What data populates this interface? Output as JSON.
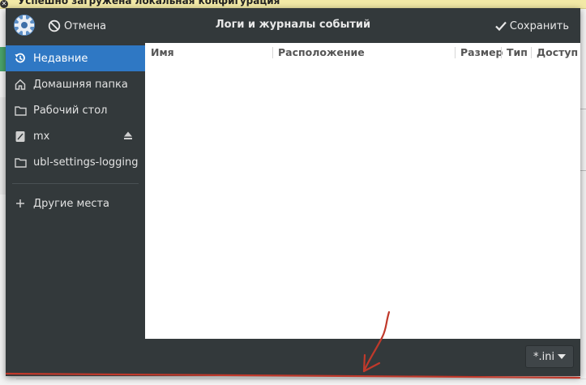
{
  "background": {
    "banner_text": "Успешно загружена локальная конфигурация"
  },
  "dialog": {
    "title": "Логи и журналы событий",
    "cancel_label": "Отмена",
    "save_label": "Сохранить"
  },
  "sidebar": {
    "items": [
      {
        "label": "Недавние",
        "icon": "recent-icon",
        "selected": true
      },
      {
        "label": "Домашняя папка",
        "icon": "home-icon"
      },
      {
        "label": "Рабочий стол",
        "icon": "folder-icon"
      },
      {
        "label": "mx",
        "icon": "drive-icon",
        "eject": true
      },
      {
        "label": "ubl-settings-logging",
        "icon": "folder-icon"
      },
      {
        "label": "Другие места",
        "icon": "plus-icon"
      }
    ]
  },
  "files": {
    "columns": [
      "Имя",
      "Расположение",
      "Размер",
      "Тип",
      "Доступ"
    ],
    "rows": []
  },
  "filter": {
    "value": "*.ini"
  },
  "colors": {
    "dialog_bg": "#33393b",
    "selection": "#2f78c4",
    "annotation": "#c0392b"
  }
}
